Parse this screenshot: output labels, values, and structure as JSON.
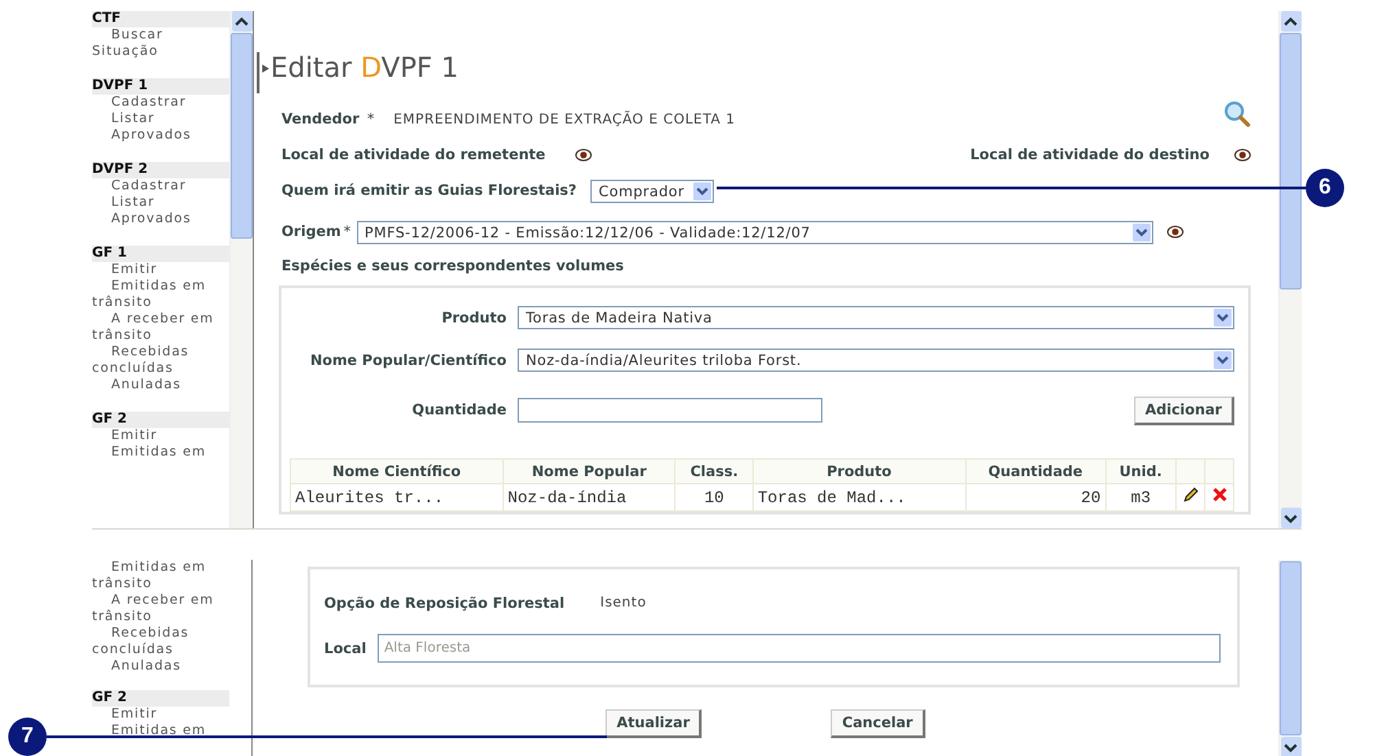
{
  "top_screen": {
    "sidebar": [
      {
        "heading": "CTF",
        "items": [
          "Buscar Situação"
        ]
      },
      {
        "heading": "DVPF 1",
        "items": [
          "Cadastrar",
          "Listar",
          "Aprovados"
        ]
      },
      {
        "heading": "DVPF 2",
        "items": [
          "Cadastrar",
          "Listar",
          "Aprovados"
        ]
      },
      {
        "heading": "GF 1",
        "items": [
          "Emitir",
          "Emitidas em trânsito",
          "A receber em trânsito",
          "Recebidas concluídas",
          "Anuladas"
        ]
      },
      {
        "heading": "GF 2",
        "items": [
          "Emitir",
          "Emitidas em"
        ]
      }
    ],
    "title": {
      "prefix": "Editar",
      "accent": "D",
      "rest": "VPF 1"
    },
    "vendedor": {
      "label": "Vendedor",
      "required_mark": "*",
      "value": "EMPREENDIMENTO DE EXTRAÇÃO E COLETA 1"
    },
    "local_remetente": {
      "label": "Local de atividade do remetente"
    },
    "local_destino": {
      "label": "Local de atividade do destino"
    },
    "emissor": {
      "label": "Quem irá emitir as Guias Florestais?",
      "value": "Comprador"
    },
    "origem": {
      "label": "Origem",
      "required_mark": "*",
      "value": "PMFS-12/2006-12 - Emissão:12/12/06 - Validade:12/12/07"
    },
    "especies": {
      "title": "Espécies e seus correspondentes volumes",
      "produto": {
        "label": "Produto",
        "value": "Toras de Madeira Nativa"
      },
      "nome": {
        "label": "Nome Popular/Científico",
        "value": "Noz-da-índia/Aleurites triloba Forst."
      },
      "quantidade": {
        "label": "Quantidade"
      },
      "add_button": "Adicionar",
      "table": {
        "columns": [
          "Nome Científico",
          "Nome Popular",
          "Class.",
          "Produto",
          "Quantidade",
          "Unid."
        ],
        "rows": [
          {
            "cells": [
              "Aleurites tr...",
              "Noz-da-índia",
              "10",
              "Toras de Mad...",
              "20",
              "m3"
            ]
          }
        ]
      }
    }
  },
  "bottom_screen": {
    "sidebar": [
      {
        "items": [
          "Emitidas em trânsito",
          "A receber em trânsito",
          "Recebidas concluídas",
          "Anuladas"
        ]
      },
      {
        "heading": "GF 2",
        "items": [
          "Emitir",
          "Emitidas em"
        ]
      }
    ],
    "reposicao": {
      "label": "Opção de Reposição Florestal",
      "value": "Isento"
    },
    "local": {
      "label": "Local",
      "value": "Alta Floresta",
      "disabled": true
    },
    "buttons": [
      "Atualizar",
      "Cancelar"
    ]
  },
  "callouts": [
    {
      "number": "6"
    },
    {
      "number": "7"
    }
  ]
}
